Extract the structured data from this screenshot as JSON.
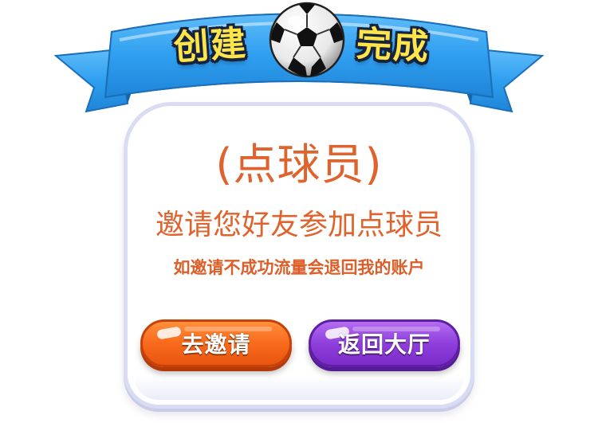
{
  "banner": {
    "title_left": "创建",
    "title_right": "完成",
    "ball_icon": "soccer-ball-icon"
  },
  "dialog": {
    "player_name": "(点球员)",
    "invite_message": "邀请您好友参加点球员",
    "note": "如邀请不成功流量会退回我的账户"
  },
  "buttons": {
    "invite_label": "去邀请",
    "back_label": "返回大厅"
  },
  "colors": {
    "ribbon": "#2f9ff0",
    "title_fill": "#ffe44a",
    "text_orange": "#e0622c",
    "invite_button": "#f96a1c",
    "back_button": "#8f3fdc",
    "card_border": "#d9dcf2"
  }
}
